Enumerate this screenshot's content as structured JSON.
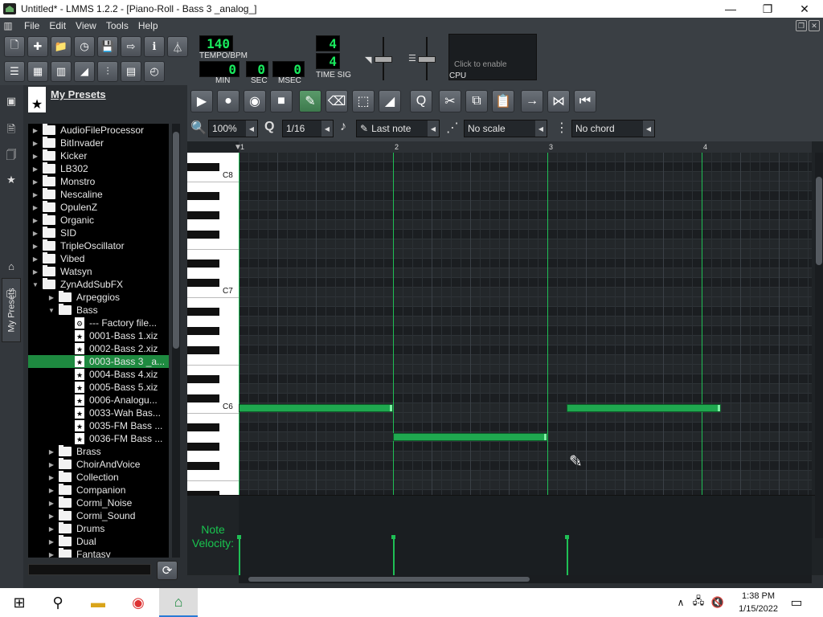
{
  "window": {
    "title": "Untitled* - LMMS 1.2.2 - [Piano-Roll - Bass 3 _analog_]",
    "min": "—",
    "restore": "❐",
    "close": "✕"
  },
  "menu": [
    "File",
    "Edit",
    "View",
    "Tools",
    "Help"
  ],
  "transport": {
    "tempo": "140",
    "tempo_label": "TEMPO/BPM",
    "min": "0",
    "sec": "0",
    "msec": "0",
    "min_label": "MIN",
    "sec_label": "SEC",
    "msec_label": "MSEC",
    "timesig_num": "4",
    "timesig_den": "4",
    "timesig_label": "TIME SIG",
    "cpu_label": "CPU",
    "cpu_hint": "Click to enable"
  },
  "sidebar": {
    "vertical_tab": "My Presets",
    "header": "My Presets",
    "items": [
      {
        "label": "AudioFileProcessor",
        "type": "folder",
        "depth": 0,
        "expanded": false
      },
      {
        "label": "BitInvader",
        "type": "folder",
        "depth": 0,
        "expanded": false
      },
      {
        "label": "Kicker",
        "type": "folder",
        "depth": 0,
        "expanded": false
      },
      {
        "label": "LB302",
        "type": "folder",
        "depth": 0,
        "expanded": false
      },
      {
        "label": "Monstro",
        "type": "folder",
        "depth": 0,
        "expanded": false
      },
      {
        "label": "Nescaline",
        "type": "folder",
        "depth": 0,
        "expanded": false
      },
      {
        "label": "OpulenZ",
        "type": "folder",
        "depth": 0,
        "expanded": false
      },
      {
        "label": "Organic",
        "type": "folder",
        "depth": 0,
        "expanded": false
      },
      {
        "label": "SID",
        "type": "folder",
        "depth": 0,
        "expanded": false
      },
      {
        "label": "TripleOscillator",
        "type": "folder",
        "depth": 0,
        "expanded": false
      },
      {
        "label": "Vibed",
        "type": "folder",
        "depth": 0,
        "expanded": false
      },
      {
        "label": "Watsyn",
        "type": "folder",
        "depth": 0,
        "expanded": false
      },
      {
        "label": "ZynAddSubFX",
        "type": "folder",
        "depth": 0,
        "expanded": true
      },
      {
        "label": "Arpeggios",
        "type": "folder",
        "depth": 1,
        "expanded": false
      },
      {
        "label": "Bass",
        "type": "folder",
        "depth": 1,
        "expanded": true
      },
      {
        "label": "--- Factory file...",
        "type": "preset",
        "depth": 2
      },
      {
        "label": "0001-Bass 1.xiz",
        "type": "preset",
        "depth": 2
      },
      {
        "label": "0002-Bass 2.xiz",
        "type": "preset",
        "depth": 2
      },
      {
        "label": "0003-Bass 3 _a...",
        "type": "preset",
        "depth": 2,
        "selected": true
      },
      {
        "label": "0004-Bass 4.xiz",
        "type": "preset",
        "depth": 2
      },
      {
        "label": "0005-Bass 5.xiz",
        "type": "preset",
        "depth": 2
      },
      {
        "label": "0006-Analogu...",
        "type": "preset",
        "depth": 2
      },
      {
        "label": "0033-Wah Bas...",
        "type": "preset",
        "depth": 2
      },
      {
        "label": "0035-FM Bass ...",
        "type": "preset",
        "depth": 2
      },
      {
        "label": "0036-FM Bass ...",
        "type": "preset",
        "depth": 2
      },
      {
        "label": "Brass",
        "type": "folder",
        "depth": 1,
        "expanded": false
      },
      {
        "label": "ChoirAndVoice",
        "type": "folder",
        "depth": 1,
        "expanded": false
      },
      {
        "label": "Collection",
        "type": "folder",
        "depth": 1,
        "expanded": false
      },
      {
        "label": "Companion",
        "type": "folder",
        "depth": 1,
        "expanded": false
      },
      {
        "label": "Cormi_Noise",
        "type": "folder",
        "depth": 1,
        "expanded": false
      },
      {
        "label": "Cormi_Sound",
        "type": "folder",
        "depth": 1,
        "expanded": false
      },
      {
        "label": "Drums",
        "type": "folder",
        "depth": 1,
        "expanded": false
      },
      {
        "label": "Dual",
        "type": "folder",
        "depth": 1,
        "expanded": false
      },
      {
        "label": "Fantasy",
        "type": "folder",
        "depth": 1,
        "expanded": false
      }
    ]
  },
  "pianoroll": {
    "zoom": "100%",
    "quantize": "1/16",
    "note_length": "Last note",
    "scale": "No scale",
    "chord": "No chord",
    "bars": [
      "1",
      "2",
      "3",
      "4"
    ],
    "octave_labels": [
      "C8",
      "C7",
      "C6"
    ],
    "velocity_label": "Note Velocity:",
    "notes": [
      {
        "pitch": "C6",
        "start_bar": 1.0,
        "end_bar": 2.0
      },
      {
        "pitch": "A5",
        "start_bar": 2.0,
        "end_bar": 3.0
      },
      {
        "pitch": "C6",
        "start_bar": 3.125,
        "end_bar": 4.125
      }
    ]
  },
  "taskbar": {
    "time": "1:38 PM",
    "date": "1/15/2022"
  },
  "colors": {
    "accent": "#1e8a40",
    "note": "#1fa84f",
    "lcd": "#19e85d"
  }
}
